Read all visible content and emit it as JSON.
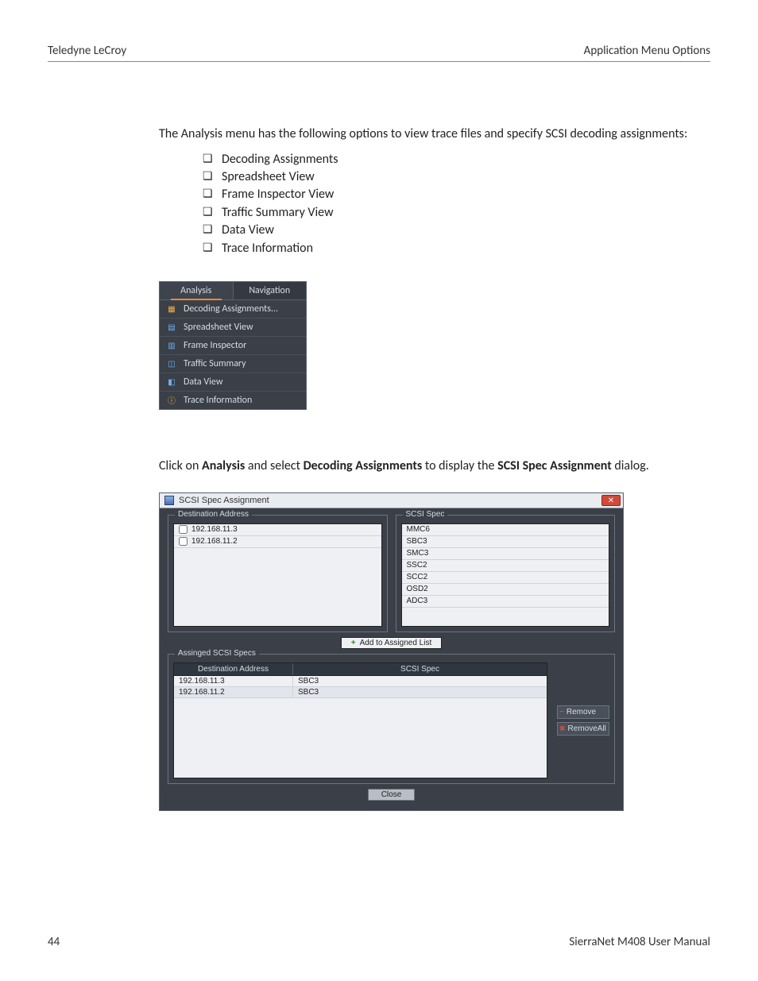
{
  "header": {
    "left": "Teledyne LeCroy",
    "right": "Application Menu Options"
  },
  "intro": "The Analysis menu has the following options to view trace files and specify SCSI decoding assignments:",
  "bullets": [
    "Decoding Assignments",
    "Spreadsheet View",
    "Frame Inspector View",
    "Traffic Summary View",
    "Data View",
    "Trace Information"
  ],
  "menu": {
    "tab_active": "Analysis",
    "tab_other": "Navigation",
    "items": [
      "Decoding Assignments...",
      "Spreadsheet View",
      "Frame Inspector",
      "Traffic Summary",
      "Data View",
      "Trace Information"
    ]
  },
  "para2": {
    "pre": "Click on ",
    "b1": "Analysis",
    "mid1": " and select ",
    "b2": "Decoding Assignments",
    "mid2": " to display the ",
    "b3": "SCSI Spec Assignment",
    "post": " dialog."
  },
  "dialog": {
    "title": "SCSI Spec Assignment",
    "group_dest": "Destination Address",
    "group_spec": "SCSI Spec",
    "dest_rows": [
      "192.168.11.3",
      "192.168.11.2"
    ],
    "spec_rows": [
      "MMC6",
      "SBC3",
      "SMC3",
      "SSC2",
      "SCC2",
      "OSD2",
      "ADC3"
    ],
    "add_btn": "Add to Assigned List",
    "group_assigned": "Assinged SCSI Specs",
    "th1": "Destination Address",
    "th2": "SCSI Spec",
    "assigned_rows": [
      {
        "addr": "192.168.11.3",
        "spec": "SBC3"
      },
      {
        "addr": "192.168.11.2",
        "spec": "SBC3"
      }
    ],
    "remove": "Remove",
    "remove_all": "RemoveAll",
    "close": "Close"
  },
  "footer": {
    "page": "44",
    "right": "SierraNet M408 User Manual"
  }
}
